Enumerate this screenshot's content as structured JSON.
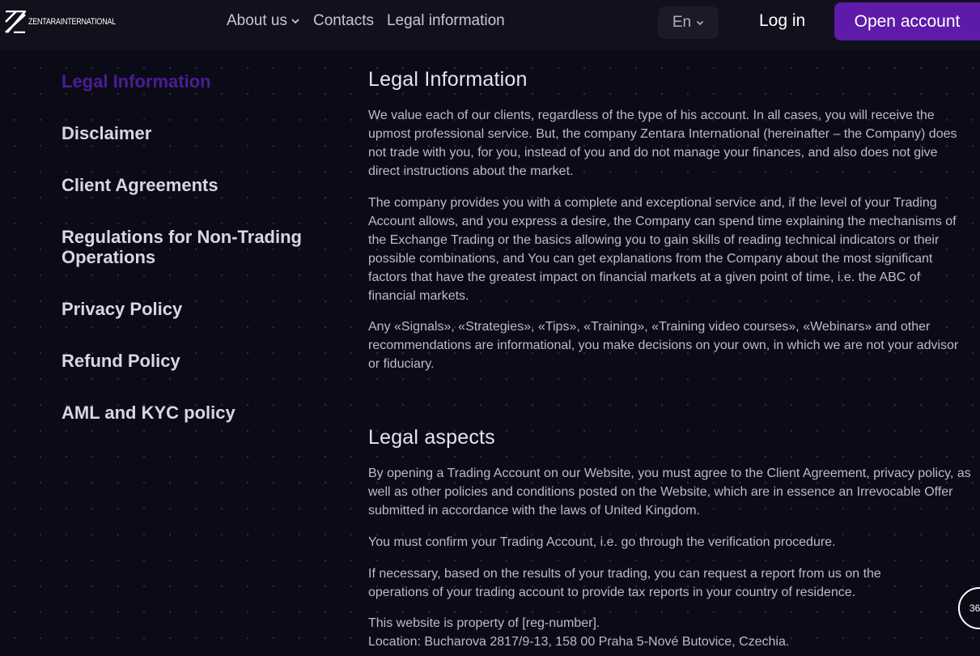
{
  "header": {
    "logo_text": "ZentaraInternational",
    "nav": [
      {
        "label": "About us",
        "has_dropdown": true
      },
      {
        "label": "Contacts",
        "has_dropdown": false
      },
      {
        "label": "Legal information",
        "has_dropdown": false
      }
    ],
    "language": "En",
    "login_label": "Log in",
    "open_account_label": "Open account"
  },
  "sidebar": {
    "items": [
      {
        "label": "Legal Information",
        "active": true
      },
      {
        "label": "Disclaimer",
        "active": false
      },
      {
        "label": "Client Agreements",
        "active": false
      },
      {
        "label": "Regulations for Non-Trading Operations",
        "active": false
      },
      {
        "label": "Privacy Policy",
        "active": false
      },
      {
        "label": "Refund Policy",
        "active": false
      },
      {
        "label": "AML and KYC policy",
        "active": false
      }
    ]
  },
  "main": {
    "sections": [
      {
        "title": "Legal Information",
        "paragraphs": [
          "We value each of our clients, regardless of the type of his account. In all cases, you will receive the upmost professional service. But, the company Zentara International (hereinafter – the Company) does not trade with you, for you, instead of you and do not manage your finances, and also does not give direct instructions about the market.",
          "The company provides you with a complete and exceptional service and, if the level of your Trading Account allows, and you express a desire, the Company can spend time explaining the mechanisms of the Exchange Trading or the basics allowing you to gain skills of reading technical indicators or their possible combinations, and You can get explanations from the Company about the most significant factors that have the greatest impact on financial markets at a given point of time, i.e. the ABC of financial markets.",
          "Any «Signals», «Strategies», «Tips», «Training», «Training video courses», «Webinars» and other recommendations are informational, you make decisions on your own, in which we are not your advisor or fiduciary."
        ]
      },
      {
        "title": "Legal aspects",
        "paragraphs": [
          "By opening a Trading Account on our Website, you must agree to the Client Agreement, privacy policy, as well as other policies and conditions posted on the Website, which are in essence an Irrevocable Offer submitted in accordance with the laws of United Kingdom.",
          "You must confirm your Trading Account, i.e. go through the verification procedure.",
          "If necessary, based on the results of your trading, you can request a report from us on the operations of your trading account to provide tax reports in your country of residence.",
          "This website is property of [reg-number].",
          "Location: Bucharova 2817/9-13, 158 00 Praha 5-Nové Butovice, Czechia."
        ]
      }
    ]
  },
  "floating_badge": {
    "text": "36"
  },
  "colors": {
    "background": "#0b0b17",
    "header": "#11111d",
    "accent": "#5e1aa8",
    "active_link": "#4c1c93"
  }
}
